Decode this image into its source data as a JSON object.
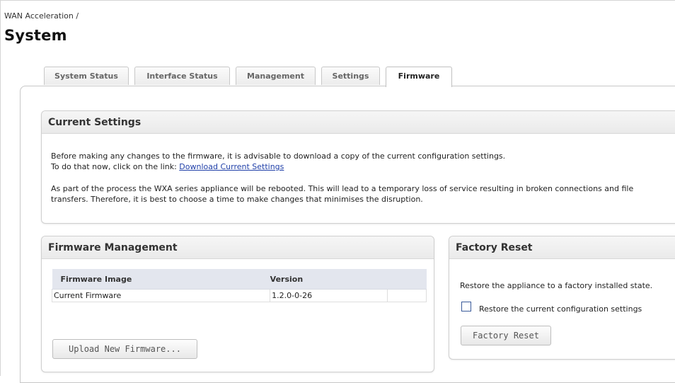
{
  "breadcrumb": "WAN Acceleration /",
  "page_title": "System",
  "tabs": [
    {
      "label": "System Status",
      "active": false
    },
    {
      "label": "Interface Status",
      "active": false
    },
    {
      "label": "Management",
      "active": false
    },
    {
      "label": "Settings",
      "active": false
    },
    {
      "label": "Firmware",
      "active": true
    }
  ],
  "current_settings": {
    "title": "Current Settings",
    "line1": "Before making any changes to the firmware, it is advisable to download a copy of the current configuration settings.",
    "line2_prefix": "To do that now, click on the link: ",
    "download_link": "Download Current Settings",
    "para2_line1": "As part of the process the WXA series appliance will be rebooted. This will lead to a temporary loss of service resulting in broken connections and file",
    "para2_line2": "transfers. Therefore, it is best to choose a time to make changes that minimises the disruption."
  },
  "firmware_management": {
    "title": "Firmware Management",
    "columns": [
      "Firmware Image",
      "Version",
      ""
    ],
    "rows": [
      {
        "image": "Current Firmware",
        "version": "1.2.0-0-26",
        "extra": ""
      }
    ],
    "upload_button": "Upload New Firmware..."
  },
  "factory_reset": {
    "title": "Factory Reset",
    "description": "Restore the appliance to a factory installed state.",
    "checkbox_label": "Restore the current configuration settings",
    "checkbox_checked": false,
    "button": "Factory Reset"
  },
  "colors": {
    "link": "#1f3fa8",
    "table_header_bg": "#e3e6ee"
  }
}
